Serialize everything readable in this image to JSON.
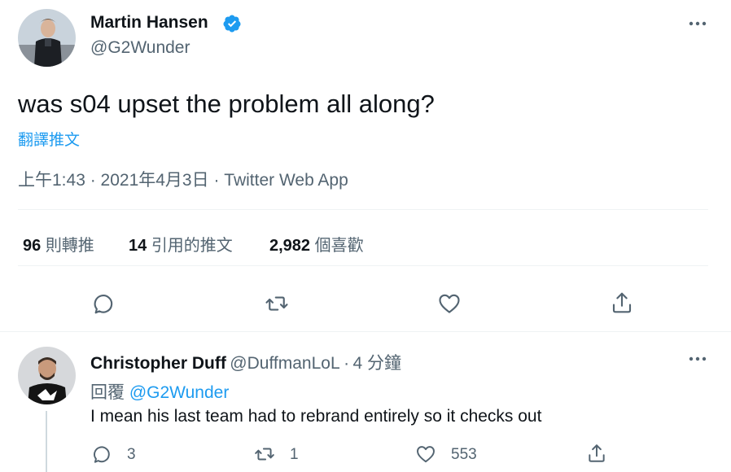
{
  "tweet": {
    "author_name": "Martin Hansen",
    "author_handle": "@G2Wunder",
    "text": "was s04 upset the problem all along?",
    "translate_label": "翻譯推文",
    "timestamp": "上午1:43 · 2021年4月3日 · Twitter Web App",
    "stats": {
      "retweets_count": "96",
      "retweets_label": "則轉推",
      "quotes_count": "14",
      "quotes_label": "引用的推文",
      "likes_count": "2,982",
      "likes_label": "個喜歡"
    },
    "actions": [
      "reply-icon",
      "retweet-icon",
      "like-icon",
      "share-icon"
    ]
  },
  "reply": {
    "author_name": "Christopher Duff",
    "author_handle": "@DuffmanLoL",
    "separator": "·",
    "time": "4 分鐘",
    "reply_prefix": "回覆",
    "reply_to": "@G2Wunder",
    "text": "I mean his last team had to rebrand entirely so it checks out",
    "counts": {
      "replies": "3",
      "retweets": "1",
      "likes": "553"
    }
  },
  "colors": {
    "accent": "#1d9bf0",
    "text_primary": "#0f1419",
    "text_secondary": "#536471",
    "divider": "#eff3f4"
  }
}
